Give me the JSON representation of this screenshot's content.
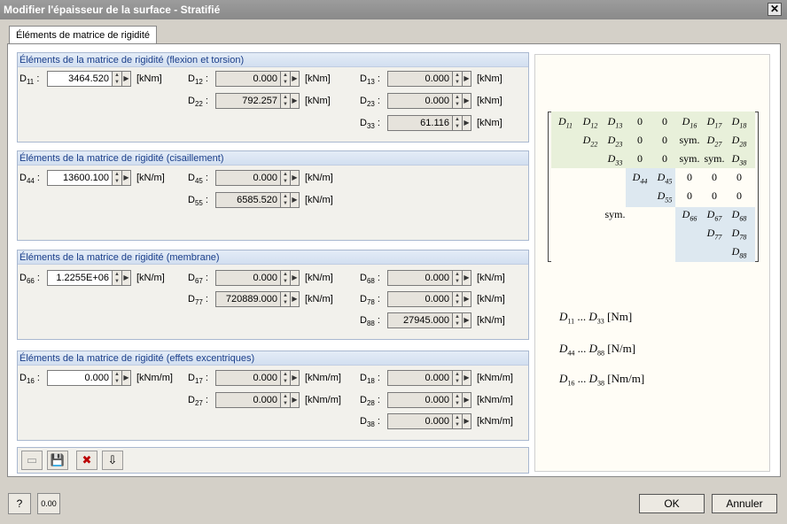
{
  "window": {
    "title": "Modifier l'épaisseur de la surface - Stratifié",
    "close": "✕"
  },
  "tab": {
    "label": "Éléments de matrice de rigidité"
  },
  "groups": {
    "flexion": {
      "title": "Éléments de la matrice de rigidité (flexion et torsion)"
    },
    "cisaillement": {
      "title": "Éléments de la matrice de rigidité (cisaillement)"
    },
    "membrane": {
      "title": "Éléments de la matrice de rigidité (membrane)"
    },
    "excentriques": {
      "title": "Éléments de la matrice de rigidité (effets excentriques)"
    }
  },
  "fields": {
    "D11": {
      "label": "D",
      "sub": "11",
      "value": "3464.520",
      "unit": "[kNm]"
    },
    "D12": {
      "label": "D",
      "sub": "12",
      "value": "0.000",
      "unit": "[kNm]"
    },
    "D13": {
      "label": "D",
      "sub": "13",
      "value": "0.000",
      "unit": "[kNm]"
    },
    "D22": {
      "label": "D",
      "sub": "22",
      "value": "792.257",
      "unit": "[kNm]"
    },
    "D23": {
      "label": "D",
      "sub": "23",
      "value": "0.000",
      "unit": "[kNm]"
    },
    "D33": {
      "label": "D",
      "sub": "33",
      "value": "61.116",
      "unit": "[kNm]"
    },
    "D44": {
      "label": "D",
      "sub": "44",
      "value": "13600.100",
      "unit": "[kN/m]"
    },
    "D45": {
      "label": "D",
      "sub": "45",
      "value": "0.000",
      "unit": "[kN/m]"
    },
    "D55": {
      "label": "D",
      "sub": "55",
      "value": "6585.520",
      "unit": "[kN/m]"
    },
    "D66": {
      "label": "D",
      "sub": "66",
      "value": "1.2255E+06",
      "unit": "[kN/m]"
    },
    "D67": {
      "label": "D",
      "sub": "67",
      "value": "0.000",
      "unit": "[kN/m]"
    },
    "D68": {
      "label": "D",
      "sub": "68",
      "value": "0.000",
      "unit": "[kN/m]"
    },
    "D77": {
      "label": "D",
      "sub": "77",
      "value": "720889.000",
      "unit": "[kN/m]"
    },
    "D78": {
      "label": "D",
      "sub": "78",
      "value": "0.000",
      "unit": "[kN/m]"
    },
    "D88": {
      "label": "D",
      "sub": "88",
      "value": "27945.000",
      "unit": "[kN/m]"
    },
    "D16": {
      "label": "D",
      "sub": "16",
      "value": "0.000",
      "unit": "[kNm/m]"
    },
    "D17": {
      "label": "D",
      "sub": "17",
      "value": "0.000",
      "unit": "[kNm/m]"
    },
    "D18": {
      "label": "D",
      "sub": "18",
      "value": "0.000",
      "unit": "[kNm/m]"
    },
    "D27": {
      "label": "D",
      "sub": "27",
      "value": "0.000",
      "unit": "[kNm/m]"
    },
    "D28": {
      "label": "D",
      "sub": "28",
      "value": "0.000",
      "unit": "[kNm/m]"
    },
    "D38": {
      "label": "D",
      "sub": "38",
      "value": "0.000",
      "unit": "[kNm/m]"
    }
  },
  "matrix": {
    "sym": "sym.",
    "zero": "0",
    "d": "D"
  },
  "legend": {
    "l1": {
      "from": "11",
      "to": "33",
      "unit": "[Nm]"
    },
    "l2": {
      "from": "44",
      "to": "88",
      "unit": "[N/m]"
    },
    "l3": {
      "from": "16",
      "to": "38",
      "unit": "[Nm/m]"
    },
    "dots": "..."
  },
  "buttons": {
    "ok": "OK",
    "cancel": "Annuler",
    "units_icon_text": "0.00"
  },
  "colors": {
    "header_text": "#1a3e8a",
    "shade_green": "#e8f0da",
    "shade_blue": "#dde8f0"
  }
}
